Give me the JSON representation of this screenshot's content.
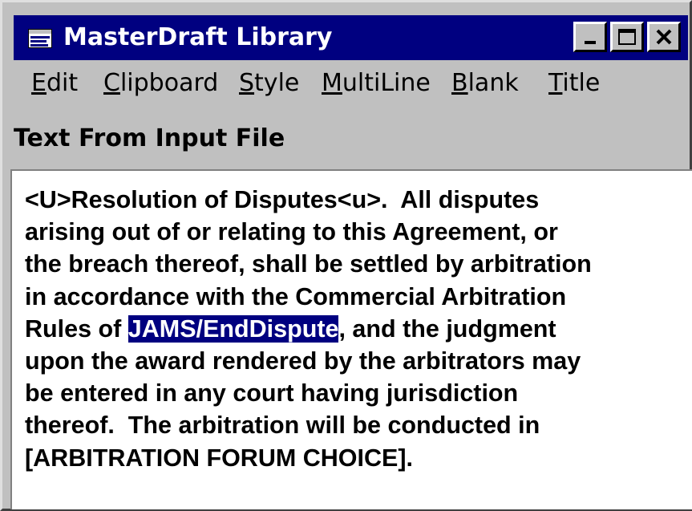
{
  "window": {
    "title": "MasterDraft Library",
    "controls": {
      "minimize": "minimize",
      "maximize": "maximize",
      "close": "close"
    }
  },
  "menu": [
    {
      "accel": "E",
      "rest": "dit"
    },
    {
      "accel": "C",
      "rest": "lipboard"
    },
    {
      "accel": "S",
      "rest": "tyle"
    },
    {
      "accel": "M",
      "rest": "ultiLine"
    },
    {
      "accel": "B",
      "rest": "lank"
    },
    {
      "accel": "T",
      "rest": "itle"
    }
  ],
  "section": {
    "label": "Text From Input File"
  },
  "document": {
    "line1": "<U>Resolution of Disputes<u>.  All disputes",
    "line2": "arising out of or relating to this Agreement, or",
    "line3": "the breach thereof, shall be settled by arbitration",
    "line4": "in accordance with the Commercial Arbitration",
    "line5_before": "Rules of ",
    "line5_selected": "JAMS/EndDispute",
    "line5_after": ", and the judgment",
    "line6": "upon the award rendered by the arbitrators may",
    "line7": "be entered in any court having jurisdiction",
    "line8": "thereof.  The arbitration will be conducted in",
    "line9": "[ARBITRATION FORUM CHOICE]."
  },
  "colors": {
    "titlebar": "#000080",
    "selection": "#000080",
    "face": "#c0c0c0",
    "text_area": "#ffffff"
  }
}
